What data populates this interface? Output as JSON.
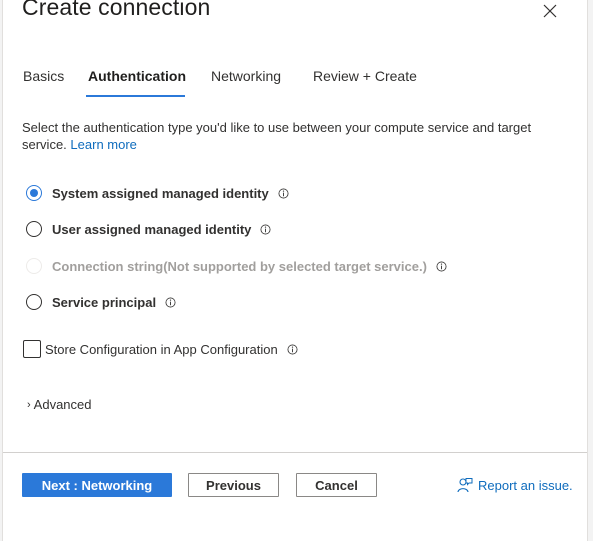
{
  "dialog": {
    "title": "Create connection",
    "close_icon": "close-icon"
  },
  "tabs": [
    {
      "label": "Basics",
      "active": false
    },
    {
      "label": "Authentication",
      "active": true
    },
    {
      "label": "Networking",
      "active": false
    },
    {
      "label": "Review + Create",
      "active": false
    }
  ],
  "description": {
    "text": "Select the authentication type you'd like to use between your compute service and target service.",
    "link_label": "Learn more"
  },
  "auth_options": [
    {
      "label": "System assigned managed identity",
      "selected": true,
      "disabled": false,
      "icon": "info-icon"
    },
    {
      "label": "User assigned managed identity",
      "selected": false,
      "disabled": false,
      "icon": "info-icon"
    },
    {
      "label": "Connection string(Not supported by selected target service.)",
      "selected": false,
      "disabled": true,
      "icon": "info-icon"
    },
    {
      "label": "Service principal",
      "selected": false,
      "disabled": false,
      "icon": "info-icon"
    }
  ],
  "store_config": {
    "label": "Store Configuration in App Configuration",
    "checked": false,
    "icon": "info-icon"
  },
  "advanced": {
    "label": "Advanced",
    "expanded": false,
    "icon": "chevron-right-icon"
  },
  "footer": {
    "next_label": "Next : Networking",
    "previous_label": "Previous",
    "cancel_label": "Cancel",
    "report_label": "Report an issue.",
    "report_icon": "feedback-person-icon"
  },
  "colors": {
    "accent": "#2b79d9",
    "link": "#0f6cbd",
    "text": "#323130",
    "disabled_text": "#a19f9d"
  }
}
